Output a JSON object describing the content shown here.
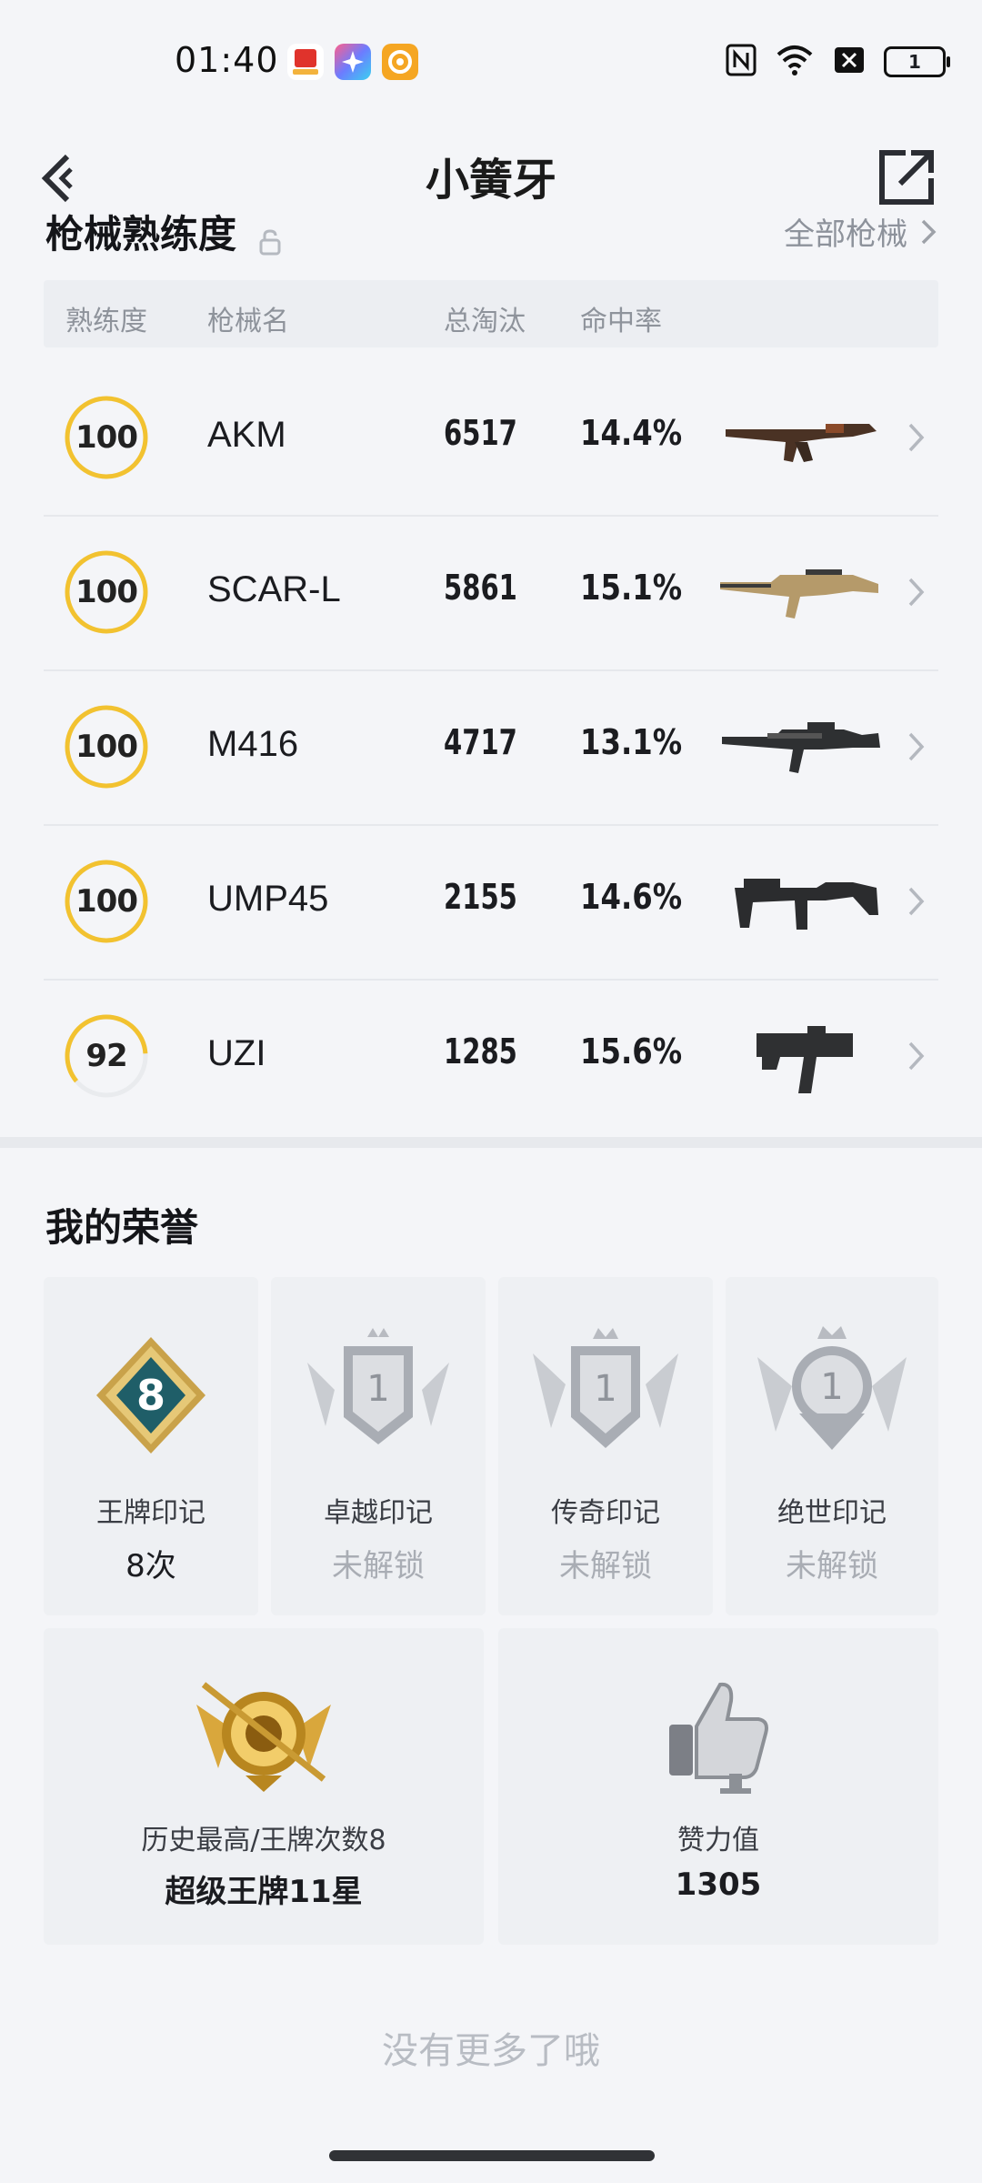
{
  "status_bar": {
    "time": "01:40",
    "battery": "1"
  },
  "nav": {
    "title": "小簧牙"
  },
  "proficiency": {
    "title": "枪械熟练度",
    "all_link": "全部枪械",
    "columns": [
      "熟练度",
      "枪械名",
      "总淘汰",
      "命中率"
    ],
    "rows": [
      {
        "level": "100",
        "progress": 1.0,
        "name": "AKM",
        "kills": "6517",
        "rate": "14.4%",
        "icon": "akm-rifle-icon"
      },
      {
        "level": "100",
        "progress": 1.0,
        "name": "SCAR-L",
        "kills": "5861",
        "rate": "15.1%",
        "icon": "scar-l-rifle-icon"
      },
      {
        "level": "100",
        "progress": 1.0,
        "name": "M416",
        "kills": "4717",
        "rate": "13.1%",
        "icon": "m416-rifle-icon"
      },
      {
        "level": "100",
        "progress": 1.0,
        "name": "UMP45",
        "kills": "2155",
        "rate": "14.6%",
        "icon": "ump45-smg-icon"
      },
      {
        "level": "92",
        "progress": 0.6,
        "name": "UZI",
        "kills": "1285",
        "rate": "15.6%",
        "icon": "uzi-smg-icon"
      }
    ]
  },
  "honors": {
    "title": "我的荣誉",
    "marks": [
      {
        "label": "王牌印记",
        "value": "8次",
        "badge_number": "8"
      },
      {
        "label": "卓越印记",
        "value": "未解锁",
        "badge_number": "1"
      },
      {
        "label": "传奇印记",
        "value": "未解锁",
        "badge_number": "1"
      },
      {
        "label": "绝世印记",
        "value": "未解锁",
        "badge_number": "1"
      }
    ],
    "best": {
      "label": "历史最高/王牌次数8",
      "value": "超级王牌11星"
    },
    "likes": {
      "label": "赞力值",
      "value": "1305"
    }
  },
  "footer": {
    "no_more": "没有更多了哦"
  },
  "colors": {
    "ring": "#f2c230",
    "accent_text": "#1b1c20",
    "muted": "#8e939b"
  }
}
